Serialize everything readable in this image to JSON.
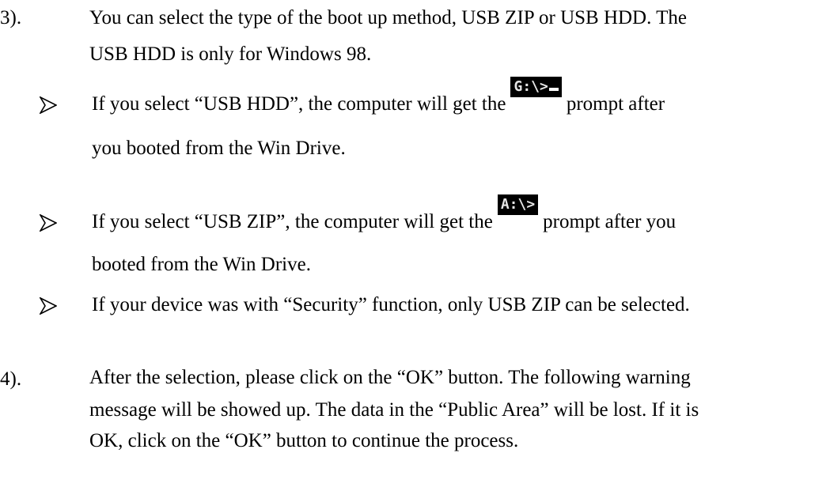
{
  "step3": {
    "number": "3).",
    "line1": "You can select the type of the boot up method, USB ZIP or USB HDD. The",
    "line2": "USB HDD is only for Windows 98."
  },
  "bullets": [
    {
      "text_before": "If you select “USB HDD”, the computer will get the",
      "prompt": "G:\\>",
      "text_after": "prompt after",
      "line2": "you booted from the Win Drive."
    },
    {
      "text_before": "If you select “USB ZIP”, the computer will get the",
      "prompt": "A:\\>",
      "text_after": "prompt after you",
      "line2": "booted from the Win Drive."
    },
    {
      "text": "If your device was with “Security” function, only USB ZIP can be selected."
    }
  ],
  "step4": {
    "number": "4).",
    "line1": "After the selection, please click on the “OK” button. The following warning",
    "line2": "message will be showed up. The data in the “Public Area” will be lost. If it is",
    "line3": "OK, click on the “OK” button to continue the process."
  },
  "icons": {
    "bullet": "arrowhead-bullet-icon"
  }
}
